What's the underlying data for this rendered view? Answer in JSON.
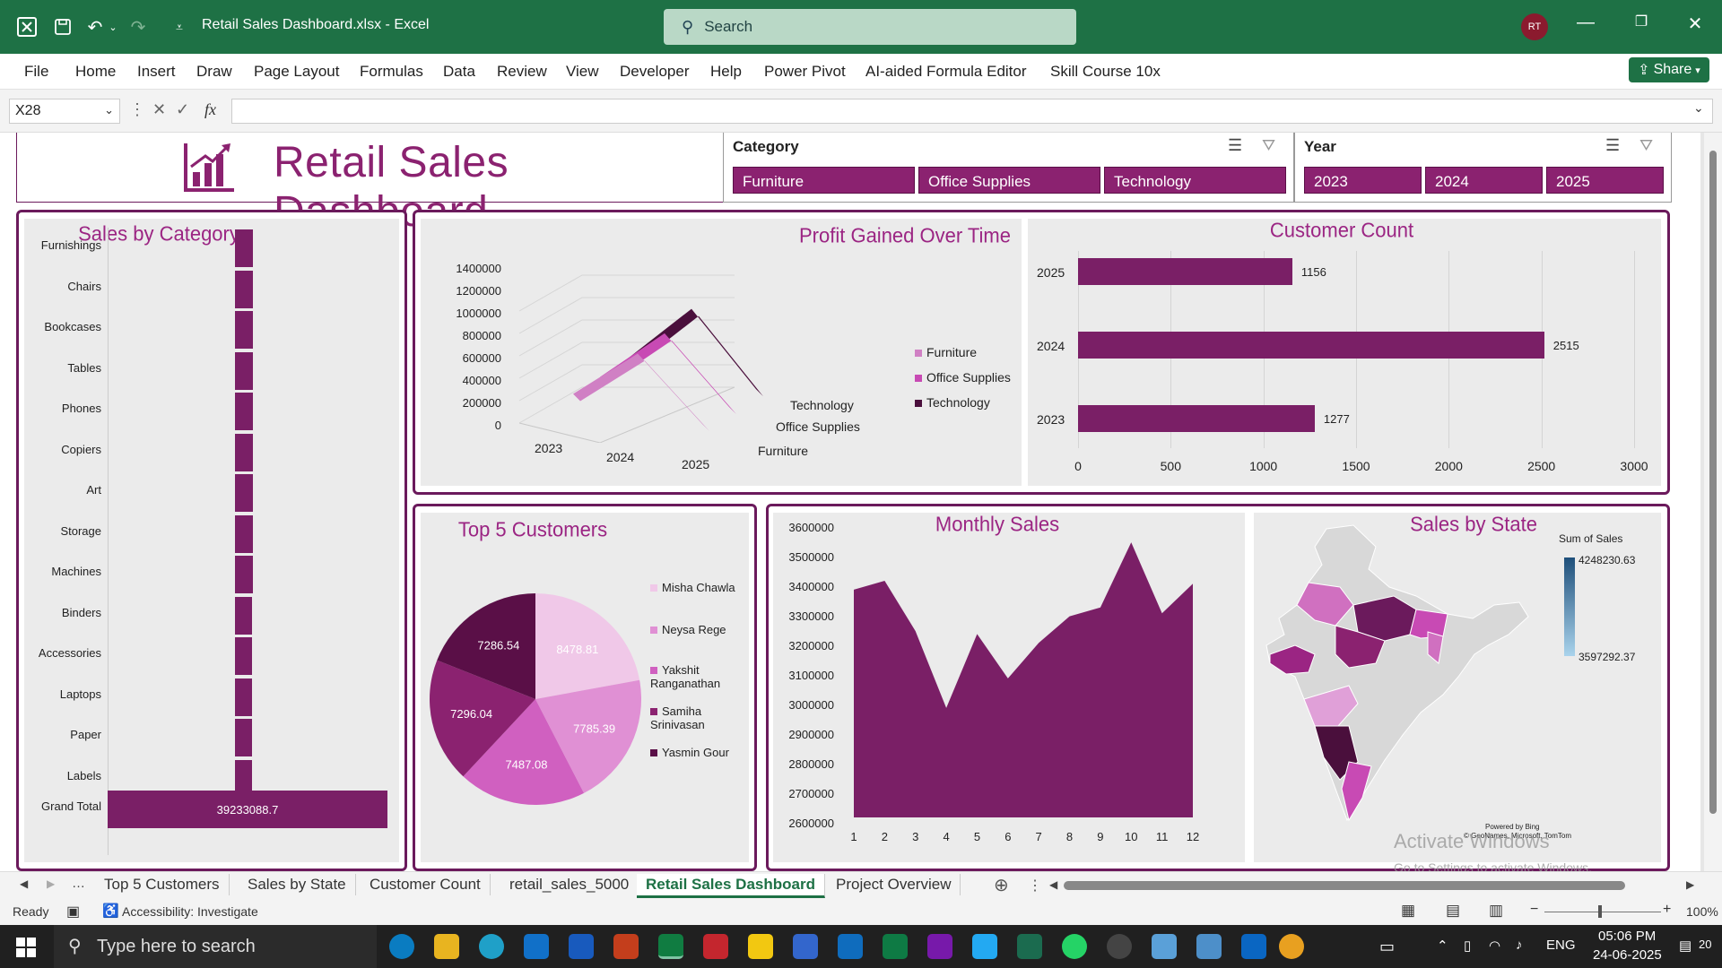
{
  "titlebar": {
    "doc_title": "Retail Sales Dashboard.xlsx  -  Excel",
    "search_placeholder": "Search",
    "avatar_initials": "RT"
  },
  "menu": [
    "File",
    "Home",
    "Insert",
    "Draw",
    "Page Layout",
    "Formulas",
    "Data",
    "Review",
    "View",
    "Developer",
    "Help",
    "Power Pivot",
    "AI-aided Formula Editor",
    "Skill Course 10x"
  ],
  "share_label": "Share",
  "formula_bar": {
    "name_box": "X28",
    "fx": "fx",
    "formula": ""
  },
  "dashboard": {
    "title": "Retail Sales Dashboard",
    "category_slicer": {
      "label": "Category",
      "items": [
        "Furniture",
        "Office Supplies",
        "Technology"
      ]
    },
    "year_slicer": {
      "label": "Year",
      "items": [
        "2023",
        "2024",
        "2025"
      ]
    }
  },
  "charts": {
    "sales_by_category": {
      "title": "Sales by Category",
      "grand_total_label": "Grand Total",
      "grand_total_value": "39233088.7"
    },
    "profit_over_time": {
      "title": "Profit Gained Over Time",
      "y_ticks": [
        "1400000",
        "1200000",
        "1000000",
        "800000",
        "600000",
        "400000",
        "200000",
        "0"
      ],
      "x_ticks": [
        "2023",
        "2024",
        "2025"
      ],
      "depth_labels": [
        "Technology",
        "Office Supplies",
        "Furniture"
      ],
      "legend": [
        "Furniture",
        "Office Supplies",
        "Technology"
      ]
    },
    "customer_count": {
      "title": "Customer Count",
      "x_ticks": [
        "0",
        "500",
        "1000",
        "1500",
        "2000",
        "2500",
        "3000"
      ]
    },
    "top5": {
      "title": "Top 5 Customers",
      "legend": [
        "Misha Chawla",
        "Neysa Rege",
        "Yakshit Ranganathan",
        "Samiha Srinivasan",
        "Yasmin Gour"
      ]
    },
    "monthly_sales": {
      "title": "Monthly Sales",
      "y_ticks": [
        "3600000",
        "3500000",
        "3400000",
        "3300000",
        "3200000",
        "3100000",
        "3000000",
        "2900000",
        "2800000",
        "2700000",
        "2600000"
      ],
      "x_ticks": [
        "1",
        "2",
        "3",
        "4",
        "5",
        "6",
        "7",
        "8",
        "9",
        "10",
        "11",
        "12"
      ]
    },
    "sales_by_state": {
      "title": "Sales by State",
      "legend_title": "Sum of Sales",
      "max_value": "4248230.63",
      "min_value": "3597292.37",
      "powered_by": "Powered by Bing",
      "copyright": "© GeoNames, Microsoft, TomTom"
    }
  },
  "chart_data": [
    {
      "type": "bar",
      "title": "Sales by Category",
      "categories": [
        "Furnishings",
        "Chairs",
        "Bookcases",
        "Tables",
        "Phones",
        "Copiers",
        "Art",
        "Storage",
        "Machines",
        "Binders",
        "Accessories",
        "Laptops",
        "Paper",
        "Labels",
        "Grand Total"
      ],
      "values": [
        2550000,
        2530000,
        2520000,
        2510000,
        2500000,
        2490000,
        2480000,
        2470000,
        2460000,
        2450000,
        2440000,
        2430000,
        2420000,
        2400000,
        39233088.7
      ],
      "orientation": "horizontal"
    },
    {
      "type": "bar",
      "title": "Customer Count",
      "categories": [
        "2025",
        "2024",
        "2023"
      ],
      "values": [
        1156,
        2515,
        1277
      ],
      "orientation": "horizontal",
      "xlim": [
        0,
        3000
      ]
    },
    {
      "type": "pie",
      "title": "Top 5 Customers",
      "categories": [
        "Misha Chawla",
        "Neysa Rege",
        "Yakshit Ranganathan",
        "Samiha Srinivasan",
        "Yasmin Gour"
      ],
      "values": [
        8478.81,
        7785.39,
        7487.08,
        7296.04,
        7286.54
      ]
    },
    {
      "type": "area",
      "title": "Monthly Sales",
      "x": [
        1,
        2,
        3,
        4,
        5,
        6,
        7,
        8,
        9,
        10,
        11,
        12
      ],
      "values": [
        3370000,
        3400000,
        3230000,
        2970000,
        3220000,
        3070000,
        3190000,
        3280000,
        3310000,
        3530000,
        3290000,
        3390000
      ],
      "ylim": [
        2600000,
        3600000
      ]
    },
    {
      "type": "line",
      "title": "Profit Gained Over Time",
      "categories": [
        "2023",
        "2024",
        "2025"
      ],
      "series": [
        {
          "name": "Furniture",
          "values": [
            350000,
            1050000,
            420000
          ]
        },
        {
          "name": "Office Supplies",
          "values": [
            360000,
            1100000,
            430000
          ]
        },
        {
          "name": "Technology",
          "values": [
            380000,
            1200000,
            450000
          ]
        }
      ],
      "ylim": [
        0,
        1400000
      ]
    }
  ],
  "sheet_tabs": [
    "Top 5 Customers",
    "Sales by State",
    "Customer Count",
    "retail_sales_5000",
    "Retail Sales Dashboard",
    "Project Overview"
  ],
  "active_tab": "Retail Sales Dashboard",
  "status": {
    "ready": "Ready",
    "accessibility": "Accessibility: Investigate",
    "zoom": "100%"
  },
  "watermark": {
    "line1": "Activate Windows",
    "line2": "Go to Settings to activate Windows."
  },
  "taskbar": {
    "search_placeholder": "Type here to search",
    "lang": "ENG",
    "time": "05:06 PM",
    "date": "24-06-2025",
    "notifications": "20"
  },
  "colors": {
    "excel_green": "#1e7145",
    "brand": "#8b2270",
    "dark": "#5a0f47",
    "light": "#d070c0"
  }
}
